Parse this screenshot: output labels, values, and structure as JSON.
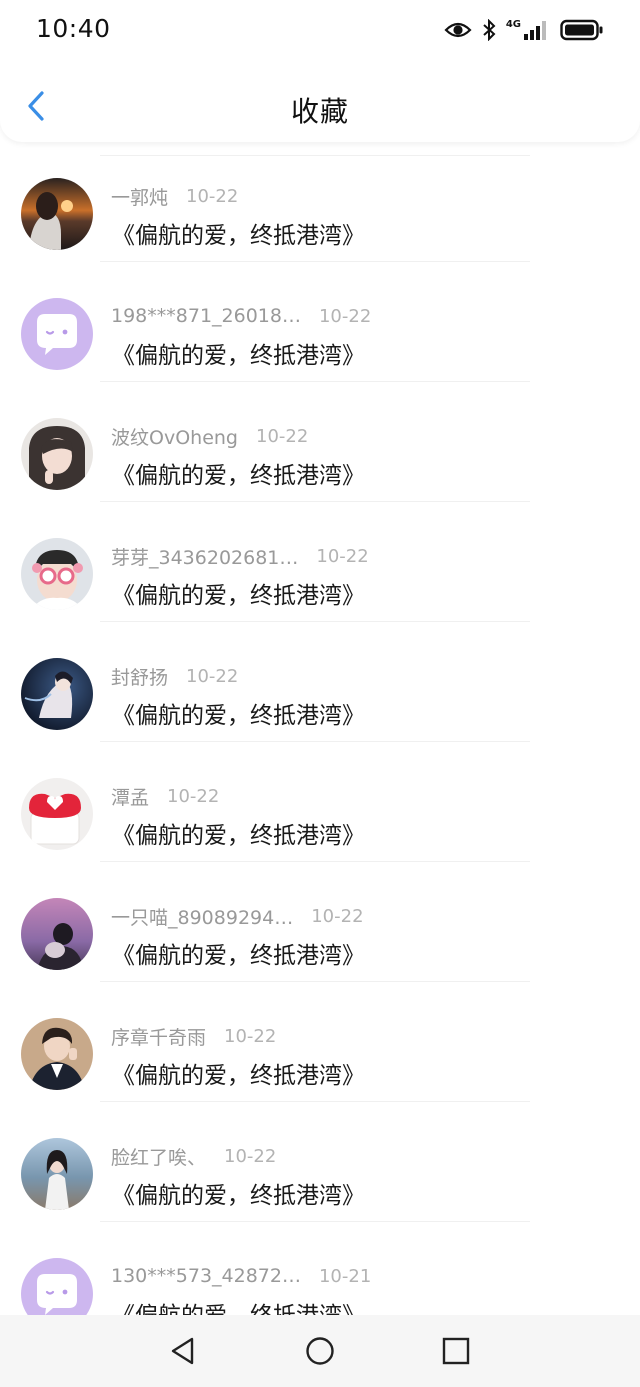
{
  "status_bar": {
    "time": "10:40",
    "network": "4G",
    "icons": [
      "eye-icon",
      "bluetooth-icon",
      "signal-icon",
      "battery-icon"
    ]
  },
  "header": {
    "title": "收藏",
    "back_icon": "chevron-left-icon",
    "accent_color": "#3a8ee6"
  },
  "favorites": [
    {
      "username": "一郭炖",
      "date": "10-22",
      "title": "《偏航的爱，终抵港湾》",
      "avatar": "photo-sunset"
    },
    {
      "username": "198***871_26018…",
      "date": "10-22",
      "title": "《偏航的爱，终抵港湾》",
      "avatar": "default-chat"
    },
    {
      "username": "波纹OvOheng",
      "date": "10-22",
      "title": "《偏航的爱，终抵港湾》",
      "avatar": "photo-girl"
    },
    {
      "username": "芽芽_3436202681…",
      "date": "10-22",
      "title": "《偏航的爱，终抵港湾》",
      "avatar": "photo-flower-glasses"
    },
    {
      "username": "封舒扬",
      "date": "10-22",
      "title": "《偏航的爱，终抵港湾》",
      "avatar": "photo-dark-anime"
    },
    {
      "username": "潭孟",
      "date": "10-22",
      "title": "《偏航的爱，终抵港湾》",
      "avatar": "photo-heart-gift"
    },
    {
      "username": "一只喵_89089294…",
      "date": "10-22",
      "title": "《偏航的爱，终抵港湾》",
      "avatar": "photo-purple-sky"
    },
    {
      "username": "序章千奇雨",
      "date": "10-22",
      "title": "《偏航的爱，终抵港湾》",
      "avatar": "photo-suit-man"
    },
    {
      "username": "脸红了唉、",
      "date": "10-22",
      "title": "《偏航的爱，终抵港湾》",
      "avatar": "photo-girl-seaside"
    },
    {
      "username": "130***573_42872…",
      "date": "10-21",
      "title": "《偏航的爱，终抵港湾》",
      "avatar": "default-chat"
    }
  ],
  "bottom_nav": {
    "buttons": [
      "back-triangle-icon",
      "home-circle-icon",
      "recents-square-icon"
    ]
  }
}
